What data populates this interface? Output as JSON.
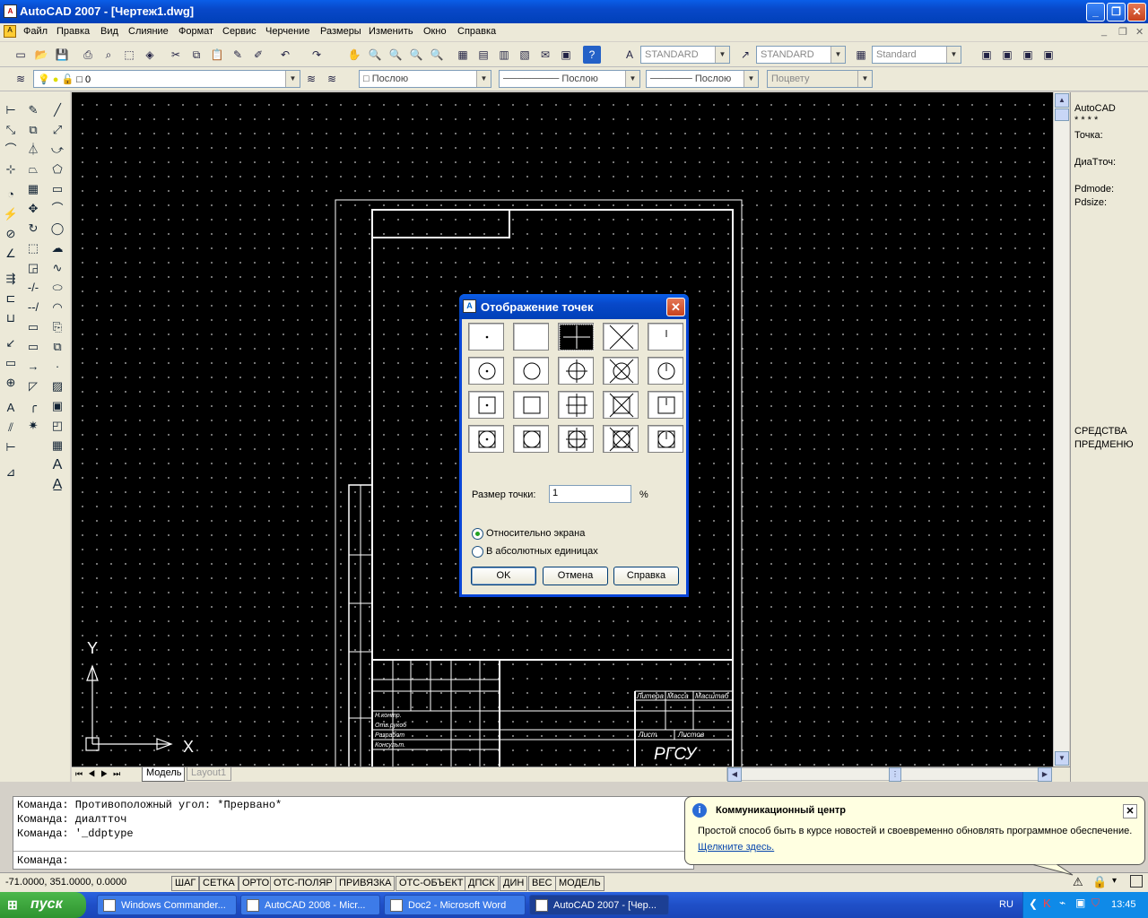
{
  "window": {
    "title": "AutoCAD 2007 - [Чертеж1.dwg]",
    "app_icon": "autocad-icon"
  },
  "menu": [
    "Файл",
    "Правка",
    "Вид",
    "Слияние",
    "Формат",
    "Сервис",
    "Черчение",
    "Размеры",
    "Изменить",
    "Окно",
    "Справка"
  ],
  "toolbar": {
    "text_style": "STANDARD",
    "dim_style": "STANDARD",
    "table_style": "Standard",
    "layer": "0",
    "color": "Послою",
    "linetype": "Послою",
    "lineweight": "Послою",
    "plot_style": "Поцвету"
  },
  "rightpanel": {
    "line1": "AutoCAD",
    "line2": "* * * *",
    "line3": "Точка:",
    "line4": "ДиаТточ:",
    "line5": "Pdmode:",
    "line6": "Pdsize:",
    "line7": "СРЕДСТВА",
    "line8": "ПРЕДМЕНЮ"
  },
  "tabs": {
    "model": "Модель",
    "layout": "Layout1"
  },
  "drawing": {
    "company": "РГСУ",
    "hdr1": "Литера",
    "hdr2": "Масса",
    "hdr3": "Масштаб",
    "sheet": "Лист",
    "sheets": "Листов",
    "row1": "Н.контр.",
    "row2": "Отв.рукоб",
    "row3": "Разработ",
    "row4": "Консульт.",
    "ucs_y": "Y",
    "ucs_x": "X"
  },
  "dialog": {
    "title": "Отображение точек",
    "size_label": "Размер точки:",
    "size_value": "1",
    "size_unit": "%",
    "radio1": "Относительно экрана",
    "radio2": "В абсолютных единицах",
    "ok": "OK",
    "cancel": "Отмена",
    "help": "Справка",
    "selected_index": 2
  },
  "command": {
    "line1": "Команда: Противоположный угол: *Прервано*",
    "line2": "Команда: диалтточ",
    "line3": "Команда: '_ddptype",
    "prompt": "Команда:"
  },
  "status": {
    "coords": "-71.0000, 351.0000, 0.0000",
    "toggles": [
      "ШАГ",
      "СЕТКА",
      "ОРТО",
      "ОТС-ПОЛЯР",
      "ПРИВЯЗКА",
      "ОТС-ОБЪЕКТ",
      "ДПСК",
      "ДИН",
      "ВЕС",
      "МОДЕЛЬ"
    ]
  },
  "balloon": {
    "title": "Коммуникационный центр",
    "text": "Простой способ быть в курсе новостей и своевременно обновлять программное обеспечение.",
    "link": "Щелкните здесь."
  },
  "taskbar": {
    "start": "пуск",
    "tasks": [
      "Windows Commander...",
      "AutoCAD 2008 - Micr...",
      "Doc2 - Microsoft Word",
      "AutoCAD 2007 - [Чер..."
    ],
    "lang": "RU",
    "clock": "13:45"
  }
}
